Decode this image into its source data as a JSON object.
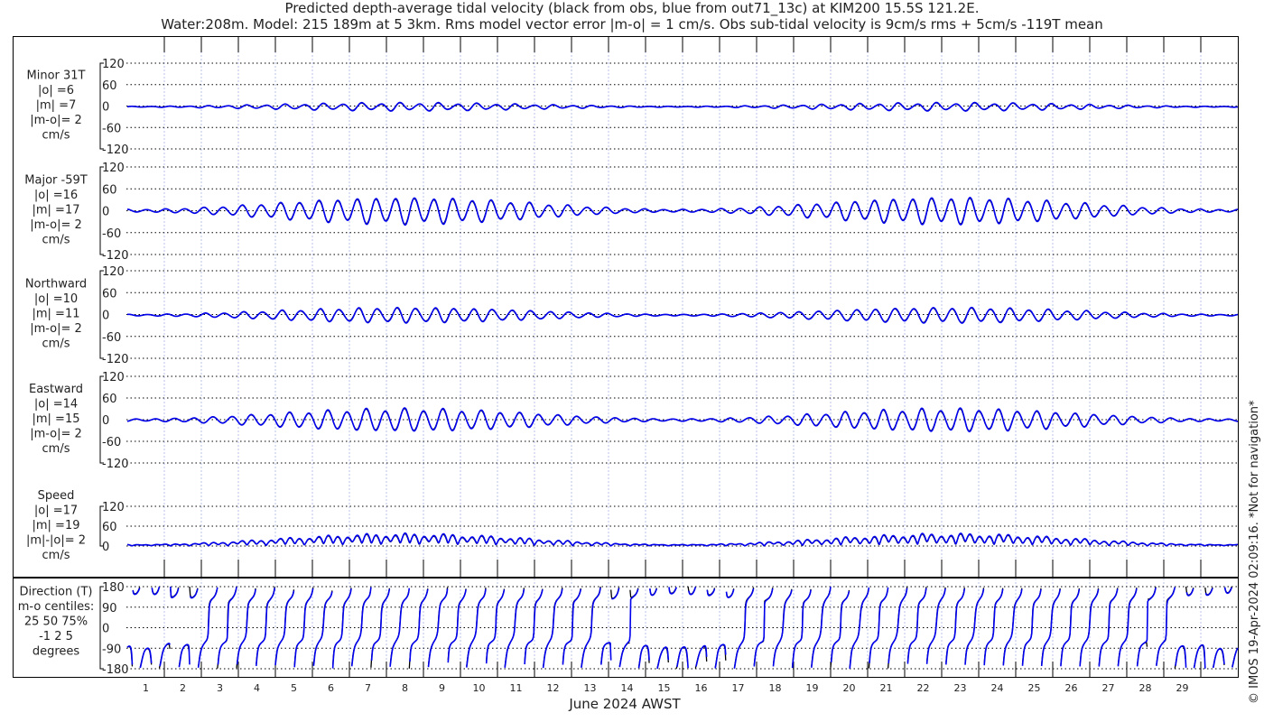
{
  "chart_data": {
    "type": "line",
    "title_line1": "Predicted depth-average tidal velocity (black from obs, blue from out71_13c) at KIM200 15.5S 121.2E.",
    "title_line2": "Water:208m. Model: 215 189m at 5 3km. Rms model vector error |m-o| = 1 cm/s. Obs sub-tidal velocity is 9cm/s rms + 5cm/s -119T mean",
    "xlabel": "June 2024 AWST",
    "x_ticks": [
      "1",
      "2",
      "3",
      "4",
      "5",
      "6",
      "7",
      "8",
      "9",
      "10",
      "11",
      "12",
      "13",
      "14",
      "15",
      "16",
      "17",
      "18",
      "19",
      "20",
      "21",
      "22",
      "23",
      "24",
      "25",
      "26",
      "27",
      "28",
      "29"
    ],
    "xlim_days": [
      0,
      30
    ],
    "series_legend": {
      "obs": "black",
      "model": "blue"
    },
    "tidal_model": {
      "period_days": 0.5175,
      "spring_neap_period_days": 14.77,
      "spring_peak_day": 7.5,
      "major_axis_deg_true": -59,
      "major_amplitude_cms": 34,
      "minor_amplitude_cms": 10
    },
    "panels": [
      {
        "key": "minor",
        "lines": [
          "Minor 31T",
          "|o| =6",
          "|m| =7",
          "|m-o|= 2",
          "cm/s"
        ],
        "ylim": [
          -120,
          120
        ],
        "yticks": [
          "120",
          "60",
          "0",
          "-60",
          "-120"
        ],
        "ytick_values": [
          120,
          60,
          0,
          -60,
          -120
        ]
      },
      {
        "key": "major",
        "lines": [
          "Major -59T",
          "|o| =16",
          "|m| =17",
          "|m-o|= 2",
          "cm/s"
        ],
        "ylim": [
          -120,
          120
        ],
        "yticks": [
          "120",
          "60",
          "0",
          "-60",
          "-120"
        ],
        "ytick_values": [
          120,
          60,
          0,
          -60,
          -120
        ]
      },
      {
        "key": "north",
        "lines": [
          "Northward",
          "|o| =10",
          "|m| =11",
          "|m-o|= 2",
          "cm/s"
        ],
        "ylim": [
          -120,
          120
        ],
        "yticks": [
          "120",
          "60",
          "0",
          "-60",
          "-120"
        ],
        "ytick_values": [
          120,
          60,
          0,
          -60,
          -120
        ]
      },
      {
        "key": "east",
        "lines": [
          "Eastward",
          "|o| =14",
          "|m| =15",
          "|m-o|= 2",
          "cm/s"
        ],
        "ylim": [
          -120,
          120
        ],
        "yticks": [
          "120",
          "60",
          "0",
          "-60",
          "-120"
        ],
        "ytick_values": [
          120,
          60,
          0,
          -60,
          -120
        ]
      },
      {
        "key": "speed",
        "lines": [
          "Speed",
          "|o| =17",
          "|m| =19",
          "|m|-|o|= 2",
          "cm/s"
        ],
        "ylim": [
          0,
          120
        ],
        "yticks": [
          "120",
          "60",
          "0"
        ],
        "ytick_values": [
          120,
          60,
          0
        ]
      },
      {
        "key": "dir",
        "lines": [
          "Direction (T)",
          "m-o centiles:",
          "25  50  75%",
          "-1  2  5",
          "degrees"
        ],
        "ylim": [
          -180,
          180
        ],
        "yticks": [
          "180",
          "90",
          "0",
          "-90",
          "-180"
        ],
        "ytick_values": [
          180,
          90,
          0,
          -90,
          -180
        ]
      }
    ],
    "colors": {
      "model": "#0000ee",
      "obs": "#000000"
    }
  },
  "footer": {
    "credit": "© IMOS 19-Apr-2024 02:09:16. *Not for navigation*"
  }
}
